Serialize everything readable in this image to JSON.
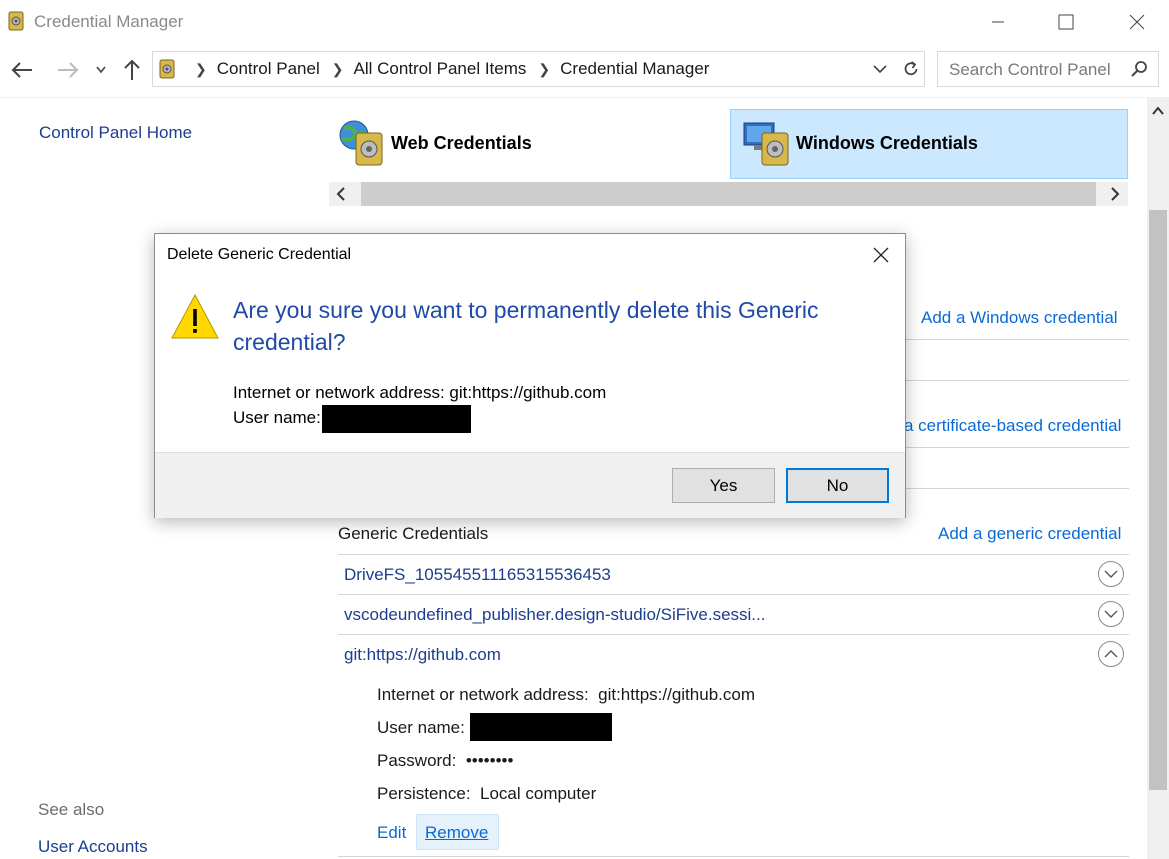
{
  "window": {
    "title": "Credential Manager",
    "icon": "credential-manager-icon",
    "buttons": [
      "minimize-icon",
      "maximize-icon",
      "close-icon"
    ]
  },
  "address_bar": {
    "breadcrumbs": [
      "Control Panel",
      "All Control Panel Items",
      "Credential Manager"
    ],
    "search_placeholder": "Search Control Panel"
  },
  "left_pane": {
    "home_link": "Control Panel Home",
    "see_also_label": "See also",
    "see_also_links": [
      "User Accounts"
    ]
  },
  "tabs": {
    "web": "Web Credentials",
    "windows": "Windows Credentials",
    "selected": "Windows Credentials"
  },
  "sections": {
    "add_windows": "Add a Windows credential",
    "add_certificate_partial": "a certificate-based credential",
    "generic_title": "Generic Credentials",
    "add_generic": "Add a generic credential"
  },
  "credentials": [
    {
      "name": "DriveFS_105545511165315536453",
      "expanded": false
    },
    {
      "name": "vscodeundefined_publisher.design-studio/SiFive.sessi...",
      "expanded": false
    },
    {
      "name": "git:https://github.com",
      "expanded": true
    }
  ],
  "expanded_details": {
    "address_label": "Internet or network address:",
    "address_value": "git:https://github.com",
    "username_label": "User name:",
    "password_label": "Password:",
    "password_value": "••••••••",
    "persistence_label": "Persistence:",
    "persistence_value": "Local computer",
    "edit": "Edit",
    "remove": "Remove"
  },
  "dialog": {
    "title": "Delete Generic Credential",
    "message": "Are you sure you want to permanently delete this Generic credential?",
    "address_line": "Internet or network address: git:https://github.com",
    "username_label": "User name:",
    "yes": "Yes",
    "no": "No",
    "default_button": "No"
  },
  "colors": {
    "link": "#1c3d8f",
    "action_link": "#0a6ad3",
    "message": "#1f4aa6",
    "tab_selected_bg": "#cce8ff",
    "default_button_border": "#0078d7"
  }
}
